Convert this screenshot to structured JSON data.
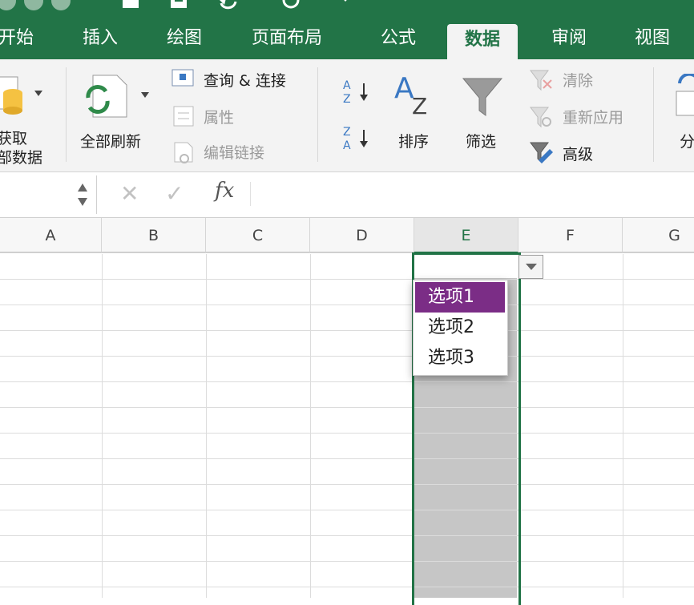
{
  "app": "Microsoft Excel",
  "colors": {
    "accent": "#227447",
    "highlight": "#7b2d86",
    "selection_fill": "#c6c6c6"
  },
  "ribbon_tabs": [
    "开始",
    "插入",
    "绘图",
    "页面布局",
    "公式",
    "数据",
    "审阅",
    "视图"
  ],
  "active_tab": "数据",
  "ribbon": {
    "get_data_label": [
      "获取",
      "部数据"
    ],
    "refresh_all": "全部刷新",
    "queries_connections": "查询 & 连接",
    "properties": "属性",
    "edit_links": "编辑链接",
    "sort": "排序",
    "filter": "筛选",
    "clear": "清除",
    "reapply": "重新应用",
    "advanced": "高级",
    "partial_next": "分",
    "sort_az_icon": "sort-az-icon",
    "sort_za_icon": "sort-za-icon"
  },
  "formula_bar": {
    "cancel": "✕",
    "enter": "✓",
    "fx": "fx",
    "value": ""
  },
  "columns": [
    "A",
    "B",
    "C",
    "D",
    "E",
    "F",
    "G"
  ],
  "selected_column": "E",
  "dropdown": {
    "options": [
      "选项1",
      "选项2",
      "选项3"
    ],
    "highlighted": "选项1"
  }
}
